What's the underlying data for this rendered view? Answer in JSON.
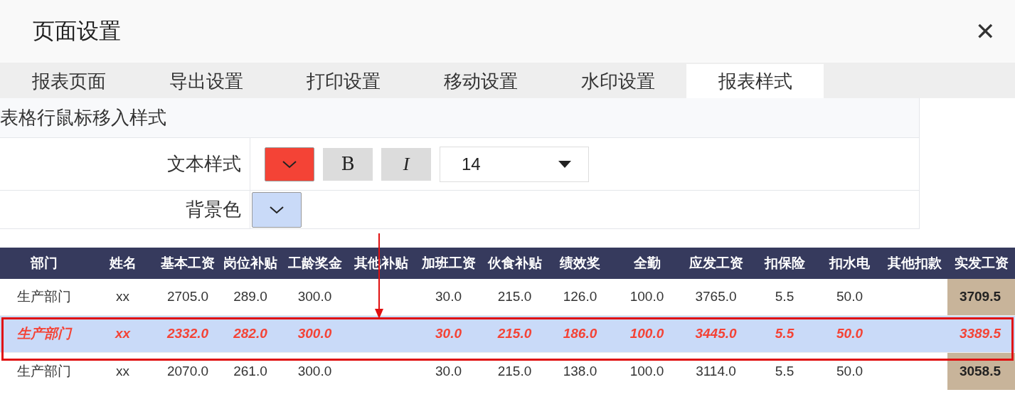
{
  "window": {
    "title": "页面设置",
    "close": "✕"
  },
  "tabs": [
    {
      "label": "报表页面",
      "selected": false
    },
    {
      "label": "导出设置",
      "selected": false
    },
    {
      "label": "打印设置",
      "selected": false
    },
    {
      "label": "移动设置",
      "selected": false
    },
    {
      "label": "水印设置",
      "selected": false
    },
    {
      "label": "报表样式",
      "selected": true
    }
  ],
  "section": {
    "title": "表格行鼠标移入样式",
    "text_style": {
      "label": "文本样式",
      "color": "#f44336",
      "bold": "B",
      "italic": "I",
      "font_size": "14"
    },
    "background": {
      "label": "背景色",
      "color": "#c9daf8"
    }
  },
  "table": {
    "columns": [
      "部门",
      "姓名",
      "基本工资",
      "岗位补贴",
      "工龄奖金",
      "其他补贴",
      "加班工资",
      "伙食补贴",
      "绩效奖",
      "全勤",
      "应发工资",
      "扣保险",
      "扣水电",
      "其他扣款",
      "实发工资"
    ],
    "rows": [
      {
        "hovered": false,
        "cells": [
          "生产部门",
          "xx",
          "2705.0",
          "289.0",
          "300.0",
          "",
          "30.0",
          "215.0",
          "126.0",
          "100.0",
          "3765.0",
          "5.5",
          "50.0",
          "",
          "3709.5"
        ]
      },
      {
        "hovered": true,
        "cells": [
          "生产部门",
          "xx",
          "2332.0",
          "282.0",
          "300.0",
          "",
          "30.0",
          "215.0",
          "186.0",
          "100.0",
          "3445.0",
          "5.5",
          "50.0",
          "",
          "3389.5"
        ]
      },
      {
        "hovered": false,
        "cells": [
          "生产部门",
          "xx",
          "2070.0",
          "261.0",
          "300.0",
          "",
          "30.0",
          "215.0",
          "138.0",
          "100.0",
          "3114.0",
          "5.5",
          "50.0",
          "",
          "3058.5"
        ]
      }
    ]
  }
}
